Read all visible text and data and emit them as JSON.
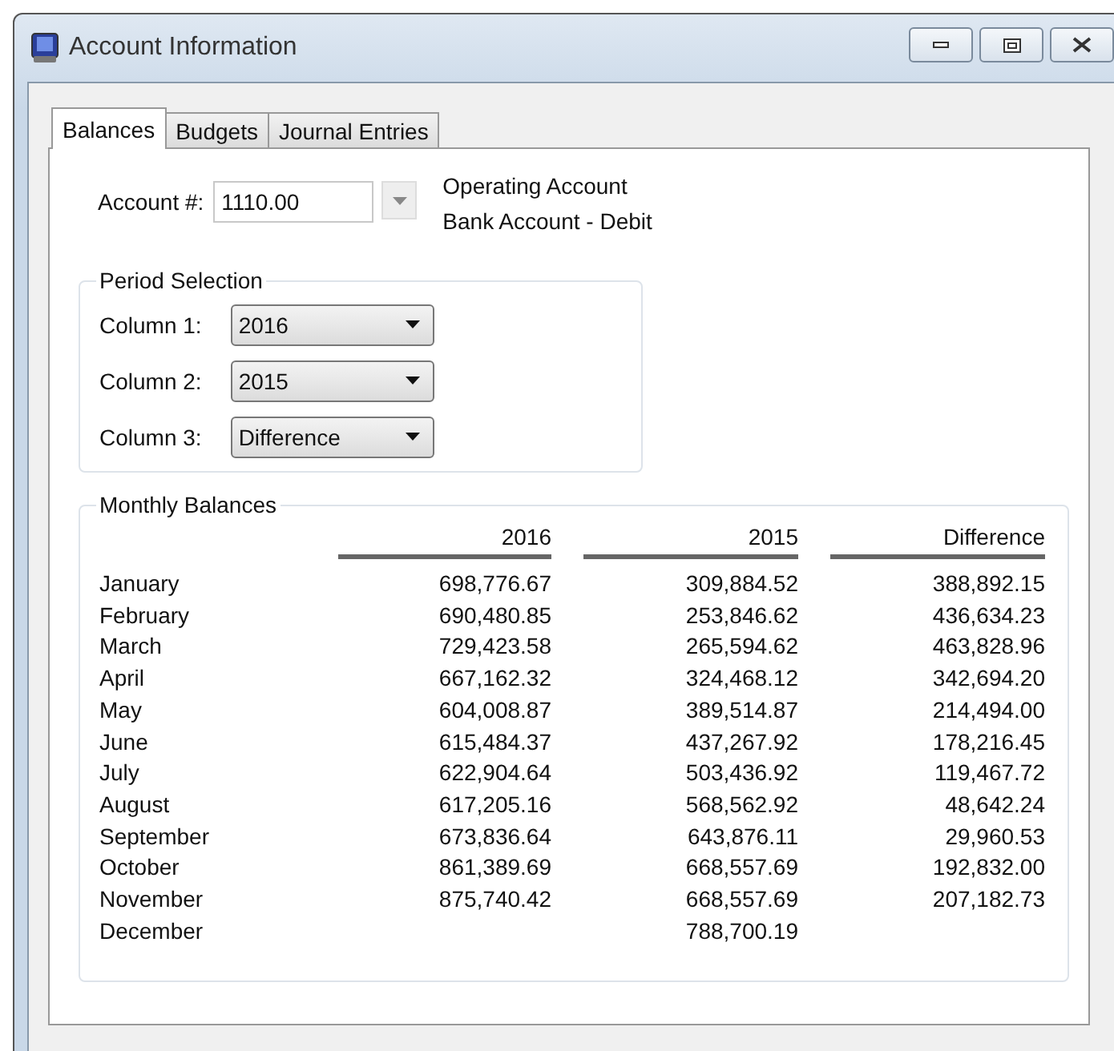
{
  "window": {
    "title": "Account Information"
  },
  "tabs": [
    {
      "label": "Balances",
      "selected": true
    },
    {
      "label": "Budgets",
      "selected": false
    },
    {
      "label": "Journal Entries",
      "selected": false
    }
  ],
  "account": {
    "label": "Account #:",
    "value": "1110.00",
    "name": "Operating Account",
    "type": "Bank Account - Debit"
  },
  "period_selection": {
    "title": "Period Selection",
    "rows": [
      {
        "label": "Column 1:",
        "value": "2016"
      },
      {
        "label": "Column 2:",
        "value": "2015"
      },
      {
        "label": "Column 3:",
        "value": "Difference"
      }
    ]
  },
  "monthly_balances": {
    "title": "Monthly Balances",
    "columns": [
      "2016",
      "2015",
      "Difference"
    ],
    "rows": [
      {
        "month": "January",
        "col_2016": "698,776.67",
        "col_2015": "309,884.52",
        "difference": "388,892.15"
      },
      {
        "month": "February",
        "col_2016": "690,480.85",
        "col_2015": "253,846.62",
        "difference": "436,634.23"
      },
      {
        "month": "March",
        "col_2016": "729,423.58",
        "col_2015": "265,594.62",
        "difference": "463,828.96"
      },
      {
        "month": "April",
        "col_2016": "667,162.32",
        "col_2015": "324,468.12",
        "difference": "342,694.20"
      },
      {
        "month": "May",
        "col_2016": "604,008.87",
        "col_2015": "389,514.87",
        "difference": "214,494.00"
      },
      {
        "month": "June",
        "col_2016": "615,484.37",
        "col_2015": "437,267.92",
        "difference": "178,216.45"
      },
      {
        "month": "July",
        "col_2016": "622,904.64",
        "col_2015": "503,436.92",
        "difference": "119,467.72"
      },
      {
        "month": "August",
        "col_2016": "617,205.16",
        "col_2015": "568,562.92",
        "difference": "48,642.24"
      },
      {
        "month": "September",
        "col_2016": "673,836.64",
        "col_2015": "643,876.11",
        "difference": "29,960.53"
      },
      {
        "month": "October",
        "col_2016": "861,389.69",
        "col_2015": "668,557.69",
        "difference": "192,832.00"
      },
      {
        "month": "November",
        "col_2016": "875,740.42",
        "col_2015": "668,557.69",
        "difference": "207,182.73"
      },
      {
        "month": "December",
        "col_2015": "788,700.19"
      }
    ]
  }
}
